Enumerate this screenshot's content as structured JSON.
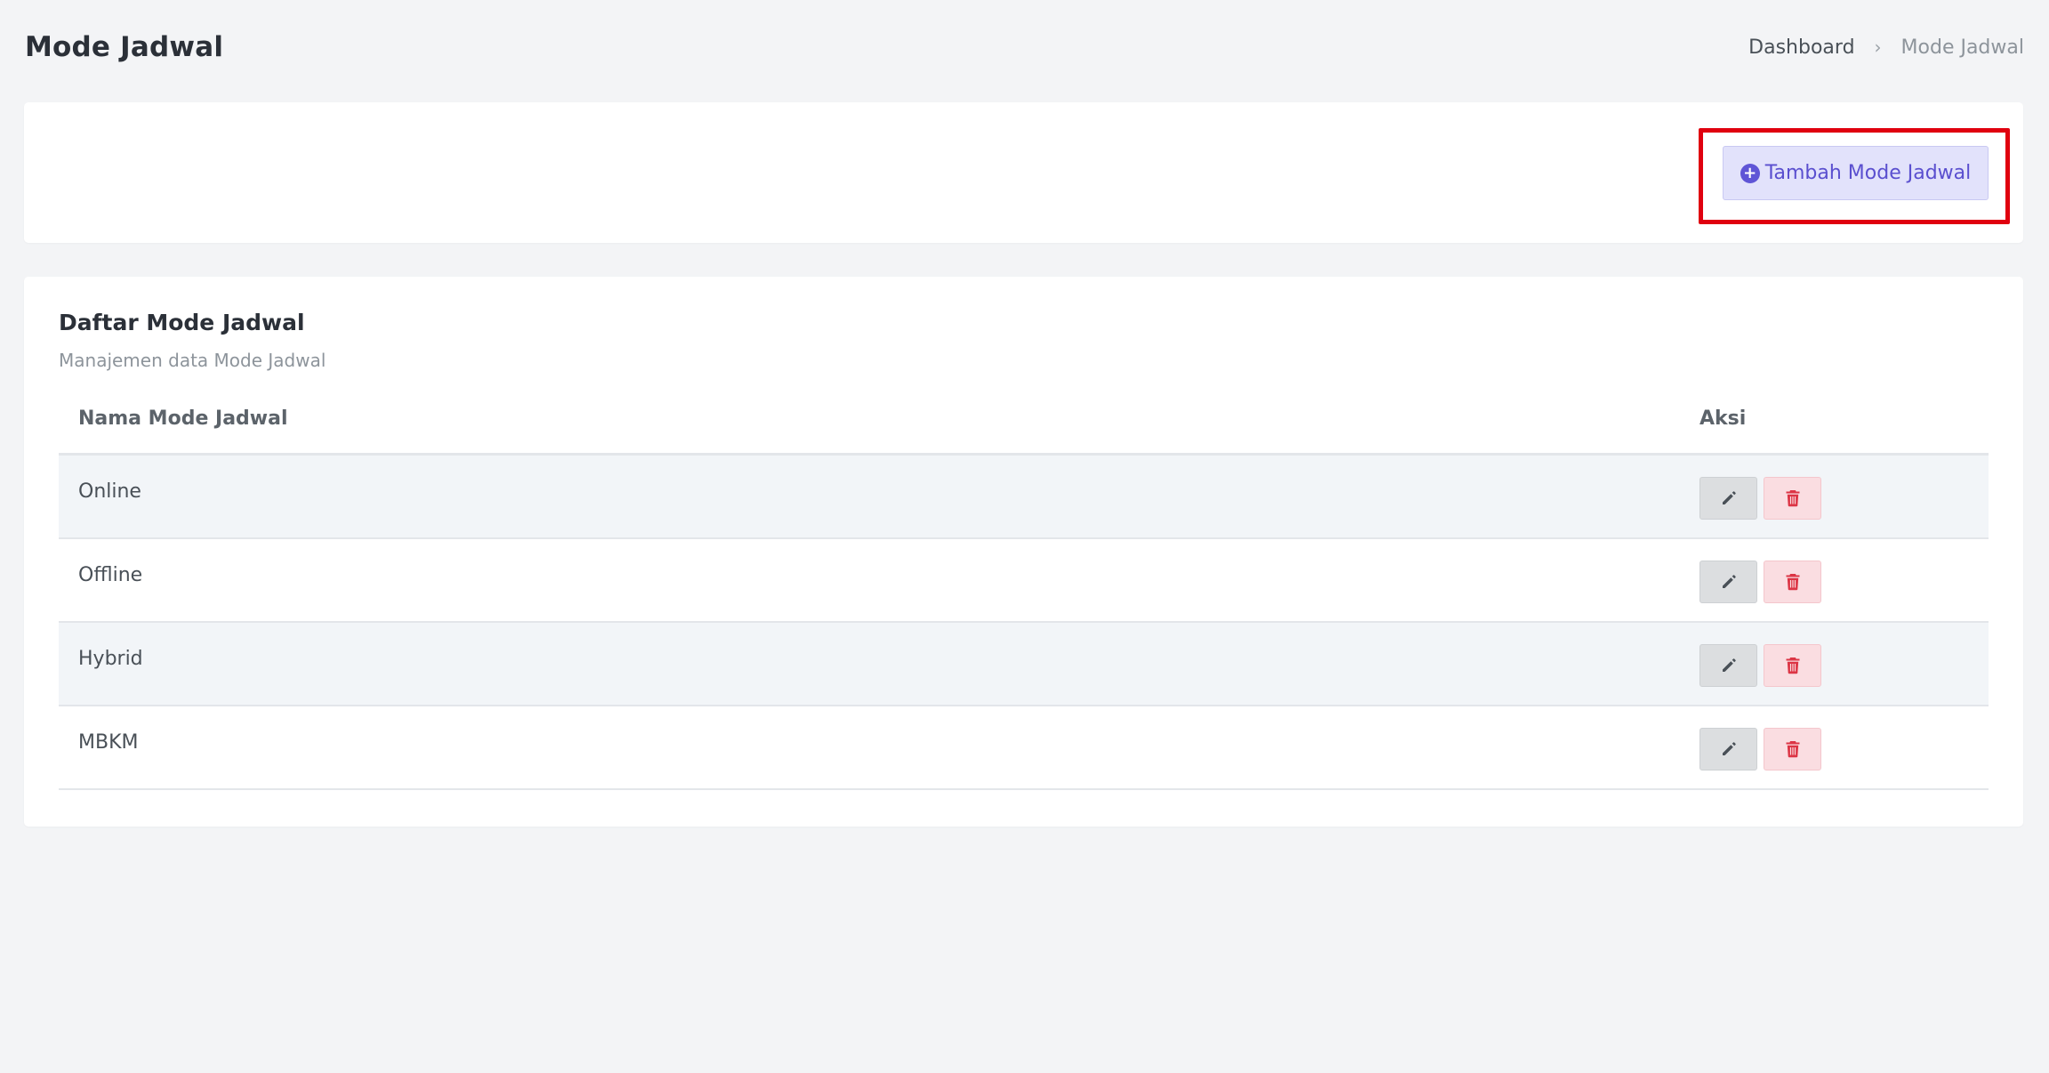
{
  "header": {
    "title": "Mode Jadwal",
    "breadcrumb": {
      "home": "Dashboard",
      "separator": "›",
      "current": "Mode Jadwal"
    }
  },
  "toolbar": {
    "add_label": "Tambah Mode Jadwal",
    "add_icon": "plus-circle-icon",
    "plus_glyph": "+"
  },
  "list": {
    "title": "Daftar Mode Jadwal",
    "subtitle": "Manajemen data Mode Jadwal",
    "columns": [
      "Nama Mode Jadwal",
      "Aksi"
    ],
    "rows": [
      {
        "name": "Online"
      },
      {
        "name": "Offline"
      },
      {
        "name": "Hybrid"
      },
      {
        "name": "MBKM"
      }
    ],
    "row_actions": [
      "pencil-icon",
      "trash-icon"
    ]
  },
  "colors": {
    "highlight": "#e0000f",
    "accent": "#5a4fcf",
    "delete": "#dc3545",
    "edit_icon": "#495057"
  }
}
